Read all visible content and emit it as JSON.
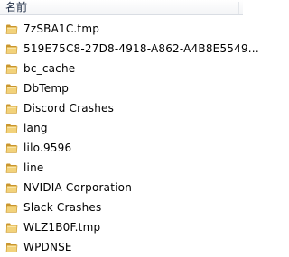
{
  "header": {
    "name_column_label": "名前"
  },
  "folders": [
    {
      "name": "7zSBA1C.tmp",
      "icon": "folder-icon"
    },
    {
      "name": "519E75C8-27D8-4918-A862-A4B8E5549...",
      "icon": "folder-icon"
    },
    {
      "name": "bc_cache",
      "icon": "folder-icon"
    },
    {
      "name": "DbTemp",
      "icon": "folder-icon"
    },
    {
      "name": "Discord Crashes",
      "icon": "folder-icon"
    },
    {
      "name": "lang",
      "icon": "folder-icon"
    },
    {
      "name": "lilo.9596",
      "icon": "folder-icon"
    },
    {
      "name": "line",
      "icon": "folder-icon"
    },
    {
      "name": "NVIDIA Corporation",
      "icon": "folder-icon"
    },
    {
      "name": "Slack Crashes",
      "icon": "folder-icon"
    },
    {
      "name": "WLZ1B0F.tmp",
      "icon": "folder-icon"
    },
    {
      "name": "WPDNSE",
      "icon": "folder-icon"
    }
  ],
  "colors": {
    "folder_fill": "#f2d27a",
    "folder_dark": "#c9962e",
    "header_text": "#1e2c44"
  }
}
